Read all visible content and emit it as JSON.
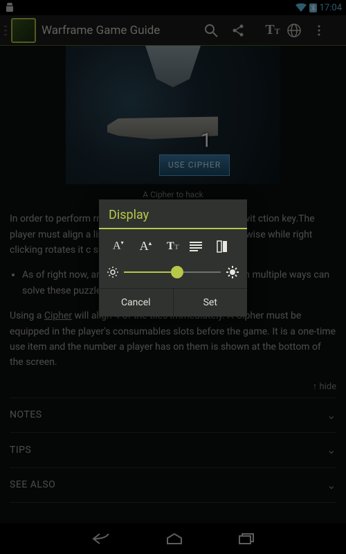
{
  "statusbar": {
    "time": "17:04"
  },
  "actionbar": {
    "title": "Warframe Game Guide"
  },
  "hero": {
    "button": "USE CIPHER",
    "number": "1"
  },
  "caption": "A Cipher to hack",
  "body": {
    "p1": "In order to perform                                                       rminal, shown as a green diamond wit                                                            ction key.The player must align a                                                                 lines on them match up. Left clic                                                                 ckwise while right clicking rotates it c                                                           seconds to perform the task. If                                                                 d.",
    "li1": "As of right now,                                                               ambiguous, but can only be solv                                                                 fit in multiple ways can solve these puzzles.",
    "p2a": "Using a ",
    "p2link": "Cipher",
    "p2b": " will align 4 of the tiles immediately. A Cipher must be equipped in the player's consumables slots before the game. It is a one-time use item and the number a player has on them is shown at the bottom of the screen."
  },
  "hide": "↑ hide",
  "sections": {
    "notes": "NOTES",
    "tips": "TIPS",
    "seealso": "SEE ALSO"
  },
  "dialog": {
    "title": "Display",
    "cancel": "Cancel",
    "set": "Set"
  }
}
